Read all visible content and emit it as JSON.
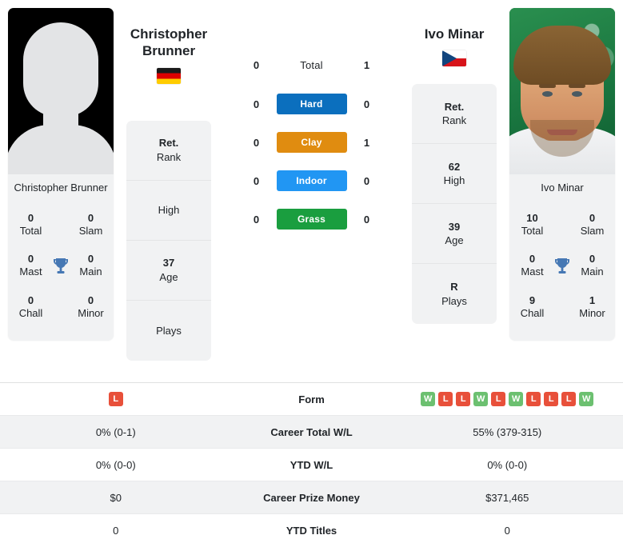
{
  "players": {
    "left": {
      "name": "Christopher Brunner",
      "display_name_line1": "Christopher",
      "display_name_line2": "Brunner",
      "country": "Germany",
      "flag": "flag-de",
      "photo": "placeholder-avatar-icon",
      "titles": {
        "total_value": "0",
        "total_label": "Total",
        "slam_value": "0",
        "slam_label": "Slam",
        "mast_value": "0",
        "mast_label": "Mast",
        "main_value": "0",
        "main_label": "Main",
        "chall_value": "0",
        "chall_label": "Chall",
        "minor_value": "0",
        "minor_label": "Minor"
      },
      "info": [
        {
          "value": "Ret.",
          "label": "Rank"
        },
        {
          "value": "",
          "label": "High"
        },
        {
          "value": "37",
          "label": "Age"
        },
        {
          "value": "",
          "label": "Plays"
        }
      ]
    },
    "right": {
      "name": "Ivo Minar",
      "display_name_line1": "Ivo Minar",
      "display_name_line2": "",
      "country": "Czech Republic",
      "flag": "flag-cz",
      "photo": "player-portrait",
      "titles": {
        "total_value": "10",
        "total_label": "Total",
        "slam_value": "0",
        "slam_label": "Slam",
        "mast_value": "0",
        "mast_label": "Mast",
        "main_value": "0",
        "main_label": "Main",
        "chall_value": "9",
        "chall_label": "Chall",
        "minor_value": "1",
        "minor_label": "Minor"
      },
      "info": [
        {
          "value": "Ret.",
          "label": "Rank"
        },
        {
          "value": "62",
          "label": "High"
        },
        {
          "value": "39",
          "label": "Age"
        },
        {
          "value": "R",
          "label": "Plays"
        }
      ]
    }
  },
  "head_to_head": [
    {
      "label": "Total",
      "left": "0",
      "right": "1",
      "color": "",
      "plain": true
    },
    {
      "label": "Hard",
      "left": "0",
      "right": "0",
      "color": "#0b6fbe",
      "plain": false
    },
    {
      "label": "Clay",
      "left": "0",
      "right": "1",
      "color": "#e08c10",
      "plain": false
    },
    {
      "label": "Indoor",
      "left": "0",
      "right": "0",
      "color": "#2196f3",
      "plain": false
    },
    {
      "label": "Grass",
      "left": "0",
      "right": "0",
      "color": "#1a9e3f",
      "plain": false
    }
  ],
  "stats_table": [
    {
      "label": "Form",
      "type": "form",
      "left_form": [
        "L"
      ],
      "right_form": [
        "W",
        "L",
        "L",
        "W",
        "L",
        "W",
        "L",
        "L",
        "L",
        "W"
      ],
      "left": "",
      "right": ""
    },
    {
      "label": "Career Total W/L",
      "type": "text",
      "left": "0% (0-1)",
      "right": "55% (379-315)"
    },
    {
      "label": "YTD W/L",
      "type": "text",
      "left": "0% (0-0)",
      "right": "0% (0-0)"
    },
    {
      "label": "Career Prize Money",
      "type": "text",
      "left": "$0",
      "right": "$371,465"
    },
    {
      "label": "YTD Titles",
      "type": "text",
      "left": "0",
      "right": "0"
    }
  ],
  "colors": {
    "hard": "#0b6fbe",
    "clay": "#e08c10",
    "indoor": "#2196f3",
    "grass": "#1a9e3f",
    "win": "#6cc070",
    "loss": "#e8503a",
    "card_bg": "#f1f2f3",
    "trophy": "#4678b4"
  }
}
